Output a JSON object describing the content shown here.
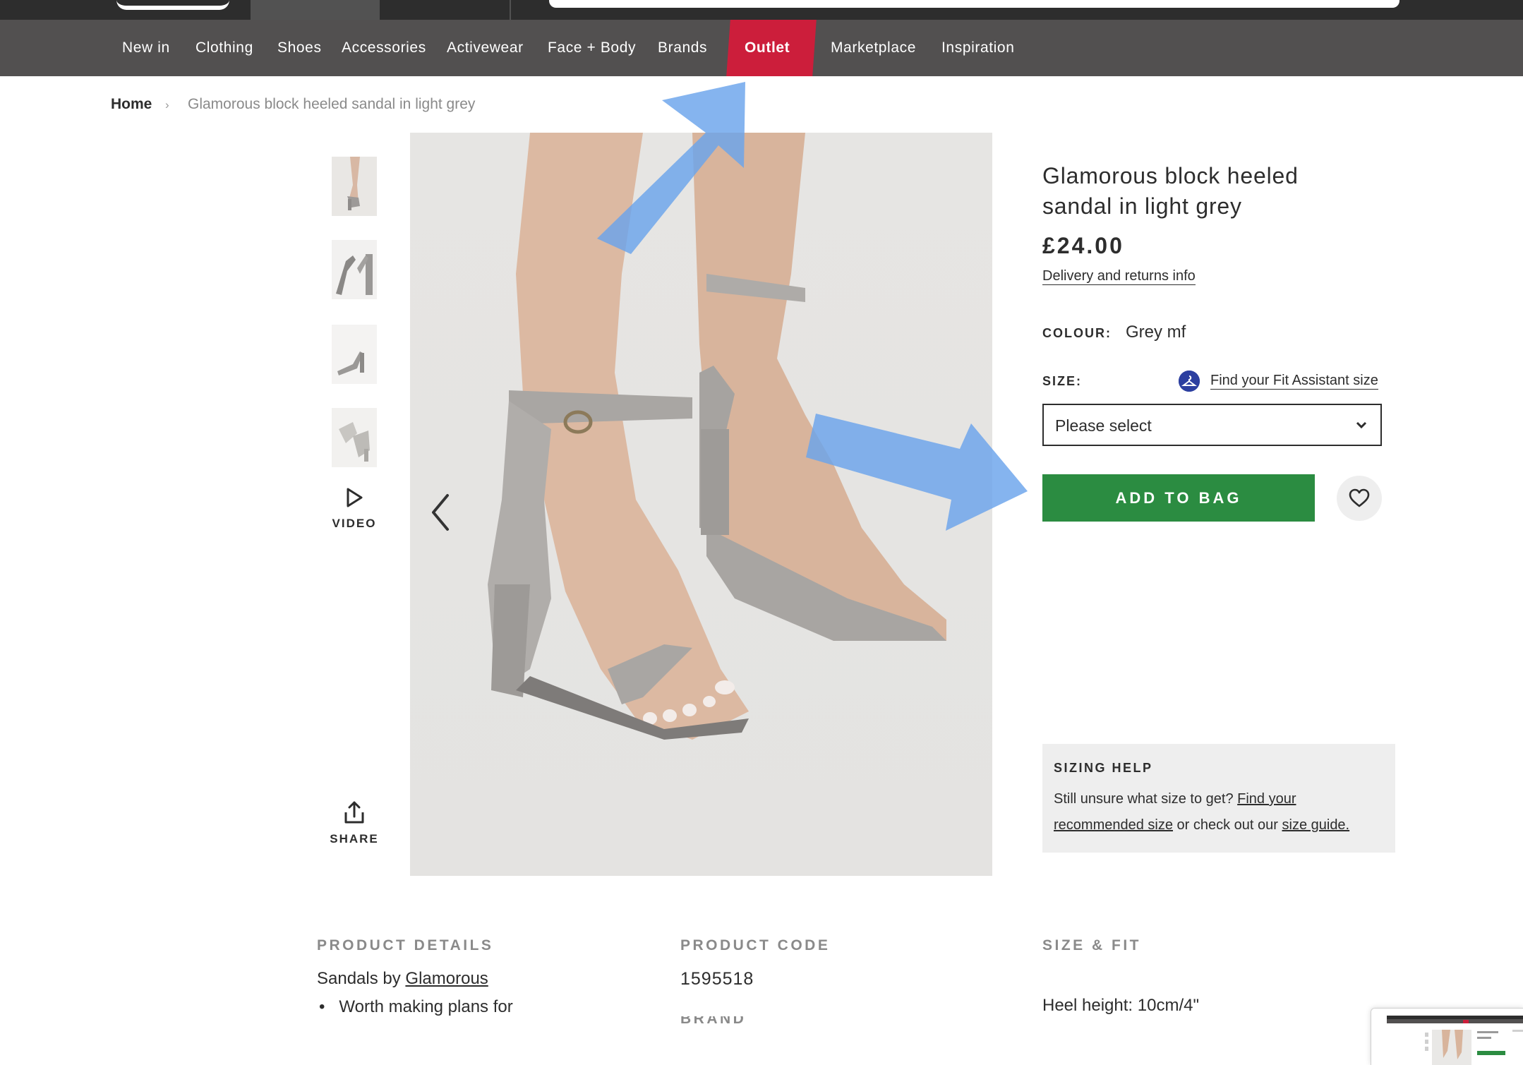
{
  "nav": {
    "items": [
      "New in",
      "Clothing",
      "Shoes",
      "Accessories",
      "Activewear",
      "Face + Body",
      "Brands",
      "Outlet",
      "Marketplace",
      "Inspiration"
    ],
    "active_color": "#cc1e3b"
  },
  "breadcrumb": {
    "home": "Home",
    "separator": "›",
    "current": "Glamorous block heeled sandal in light grey"
  },
  "gallery": {
    "video_label": "VIDEO",
    "share_label": "SHARE"
  },
  "product": {
    "title_line1": "Glamorous block heeled",
    "title_line2": "sandal in light grey",
    "price": "£24.00",
    "delivery_link": "Delivery and returns info",
    "colour_label": "COLOUR:",
    "colour_value": "Grey mf",
    "size_label": "SIZE:",
    "fit_assistant_link": "Find your Fit Assistant size",
    "size_select_placeholder": "Please select",
    "add_to_bag": "ADD TO BAG"
  },
  "sizing_help": {
    "heading": "SIZING HELP",
    "text_1": "Still unsure what size to get? ",
    "link_1": "Find your recommended size",
    "text_2": " or check out our ",
    "link_2": "size guide."
  },
  "details": {
    "product_details_heading": "PRODUCT DETAILS",
    "sandals_text": "Sandals by ",
    "brand_link": "Glamorous",
    "bullet_1": "Worth making plans for",
    "product_code_heading": "PRODUCT CODE",
    "product_code": "1595518",
    "brand_heading": "BRAND",
    "size_fit_heading": "SIZE & FIT",
    "heel_height": "Heel height: 10cm/4\""
  },
  "colors": {
    "add_to_bag_green": "#2b8c41",
    "annotation_arrow": "#6aa3ec"
  }
}
